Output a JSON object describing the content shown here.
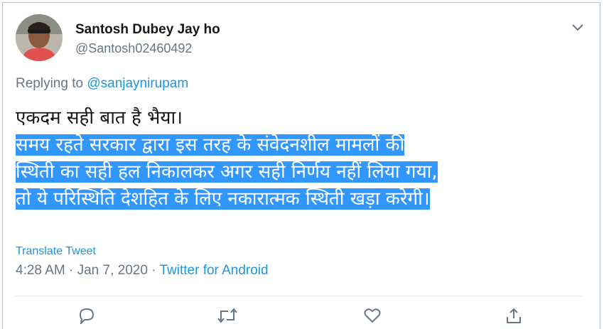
{
  "user": {
    "display_name": "Santosh Dubey Jay ho",
    "handle": "@Santosh02460492"
  },
  "reply": {
    "prefix": "Replying to ",
    "mention": "@sanjaynirupam"
  },
  "tweet": {
    "lines": [
      "एकदम सही बात है भैया।",
      "समय रहते सरकार द्वारा इस तरह के संवेदनशील मामलों की",
      "स्थिती का सही हल निकालकर अगर सही निर्णय नहीं लिया गया,",
      "तो ये परिस्थिति देशहित के लिए नकारात्मक स्थिती खड़ा करेगी।"
    ]
  },
  "translate_label": "Translate Tweet",
  "meta": {
    "time": "4:28 AM",
    "separator1": " · ",
    "date": "Jan 7, 2020",
    "separator2": " · ",
    "source": "Twitter for Android"
  },
  "icons": {
    "caret": "chevron-down-icon",
    "reply": "reply-icon",
    "retweet": "retweet-icon",
    "like": "heart-icon",
    "share": "share-icon"
  },
  "colors": {
    "link": "#1b95e0",
    "muted": "#657786",
    "selection": "#3297fd"
  }
}
